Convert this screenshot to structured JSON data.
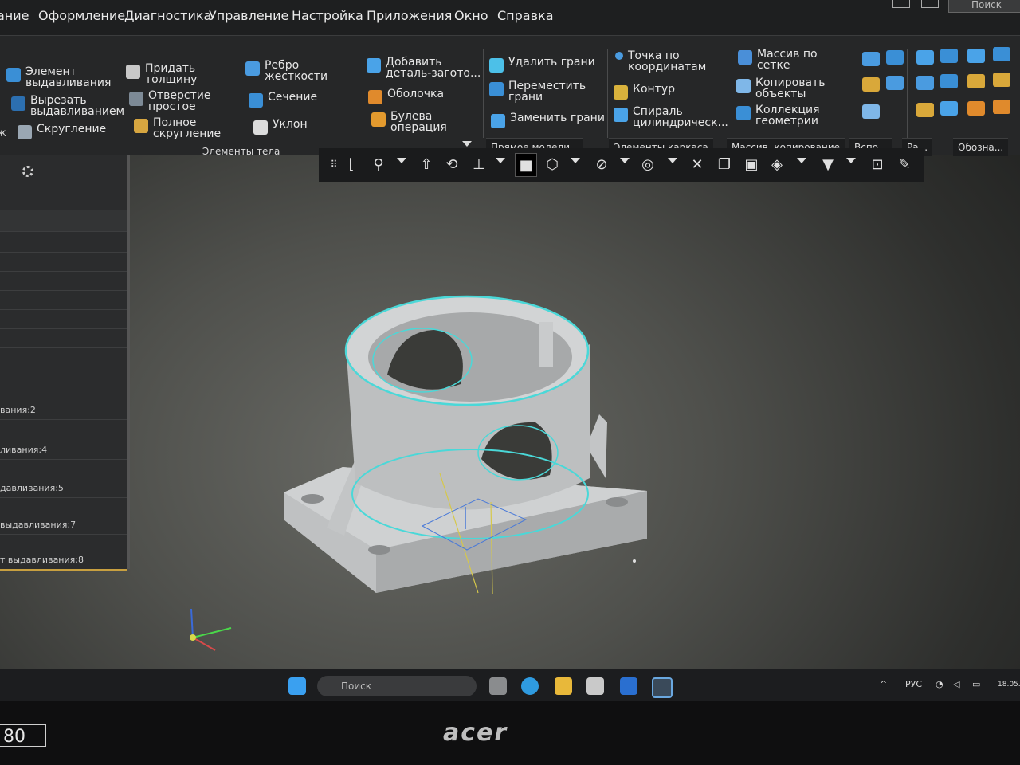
{
  "colors": {
    "menubar_bg": "#1e1f20",
    "ribbon_bg": "#262728",
    "viewport_bg": "#4f504c",
    "selection_outline": "#4ad8d8",
    "model_face": "#c9cbcc"
  },
  "menu": {
    "items": [
      "ание",
      "Оформление",
      "Диагностика",
      "Управление",
      "Настройка",
      "Приложения",
      "Окно",
      "Справка"
    ],
    "search_placeholder": "Поиск"
  },
  "ribbon": {
    "body_group": {
      "buttons": [
        "Элемент\nвыдавливания",
        "Вырезать\nвыдавливанием",
        "Скругление",
        "Придать\nтолщину",
        "Отверстие\nпростое",
        "Полное\nскругление",
        "Ребро\nжесткости",
        "Сечение",
        "Уклон",
        "Добавить\nдеталь-загото...",
        "Оболочка",
        "Булева\nоперация"
      ],
      "title": "Элементы тела",
      "left_fragment": "ж"
    },
    "direct_group": {
      "buttons": [
        "Удалить грани",
        "Переместить\nграни",
        "Заменить грани"
      ],
      "title": "Прямое модели..."
    },
    "frame_group": {
      "buttons": [
        "Точка по\nкоординатам",
        "Контур",
        "Спираль\nцилиндрическ..."
      ],
      "title": "Элементы каркаса"
    },
    "array_group": {
      "buttons": [
        "Массив по\nсетке",
        "Копировать\nобъекты",
        "Коллекция\nгеометрии"
      ],
      "title": "Массив, копирование"
    },
    "small_groups": [
      "Вспо...",
      "Ра...",
      "Обозна..."
    ]
  },
  "tree": {
    "rows": [
      "вания:2",
      "ливания:4",
      "давливания:5",
      "выдавливания:7",
      "т выдавливания:8"
    ]
  },
  "taskbar": {
    "search_label": "Поиск",
    "lang": "РУС",
    "date": "18.05."
  },
  "bezel": {
    "brand": "acer",
    "badge": "80"
  }
}
